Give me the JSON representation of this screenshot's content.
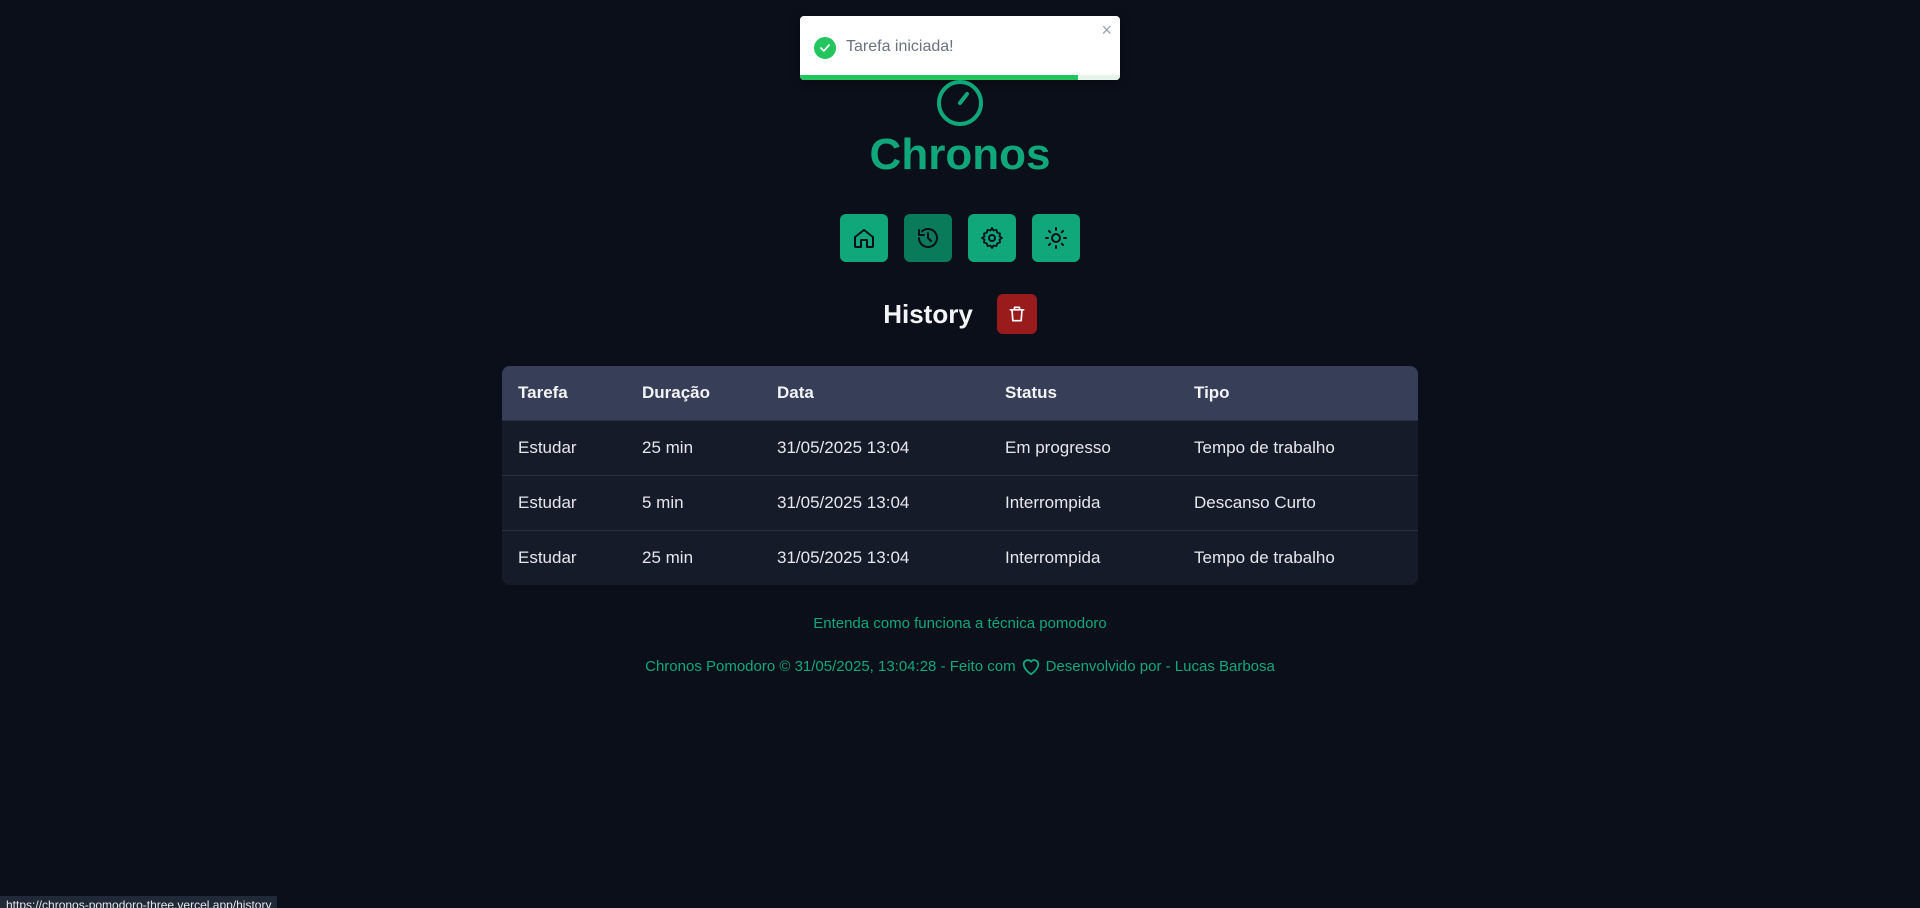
{
  "toast": {
    "message": "Tarefa iniciada!",
    "close": "×",
    "progress": 0.87
  },
  "app": {
    "title": "Chronos"
  },
  "nav": [
    {
      "name": "home",
      "icon": "home-icon"
    },
    {
      "name": "history",
      "icon": "history-icon",
      "active": true
    },
    {
      "name": "settings",
      "icon": "gear-icon"
    },
    {
      "name": "theme",
      "icon": "sun-icon"
    }
  ],
  "history": {
    "title": "History"
  },
  "table": {
    "headers": [
      "Tarefa",
      "Duração",
      "Data",
      "Status",
      "Tipo"
    ],
    "rows": [
      [
        "Estudar",
        "25 min",
        "31/05/2025 13:04",
        "Em progresso",
        "Tempo de trabalho"
      ],
      [
        "Estudar",
        "5 min",
        "31/05/2025 13:04",
        "Interrompida",
        "Descanso Curto"
      ],
      [
        "Estudar",
        "25 min",
        "31/05/2025 13:04",
        "Interrompida",
        "Tempo de trabalho"
      ]
    ]
  },
  "footer": {
    "link": "Entenda como funciona a técnica pomodoro",
    "left": "Chronos Pomodoro © 31/05/2025, 13:04:28 - Feito com",
    "right": "Desenvolvido por - Lucas Barbosa"
  },
  "status_url": "https://chronos-pomodoro-three.vercel.app/history",
  "colors": {
    "accent": "#10a87a",
    "danger": "#991b1b",
    "background": "#0b0f1a",
    "success": "#22c55e"
  }
}
